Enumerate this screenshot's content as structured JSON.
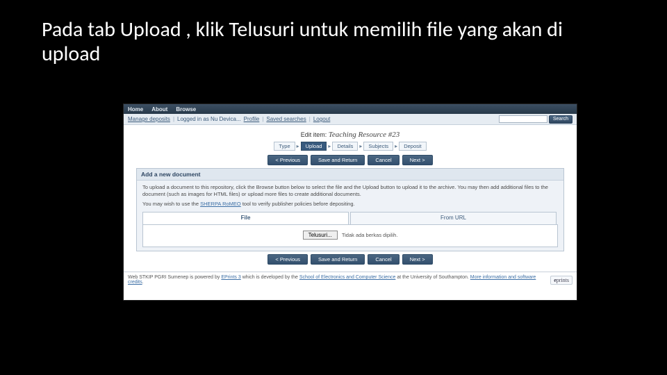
{
  "slide": {
    "title": "Pada tab Upload , klik Telusuri untuk memilih file yang akan di upload"
  },
  "nav": {
    "home": "Home",
    "about": "About",
    "browse": "Browse"
  },
  "userbar": {
    "manage": "Manage deposits",
    "logged": "Logged in as Nu Devica...",
    "profile": "Profile",
    "saved": "Saved searches",
    "logout": "Logout"
  },
  "search": {
    "placeholder": "",
    "button": "Search"
  },
  "edit": {
    "prefix": "Edit item:",
    "itemname": "Teaching Resource #23",
    "steps": [
      "Type",
      "Upload",
      "Details",
      "Subjects",
      "Deposit"
    ],
    "activeIndex": 1
  },
  "buttons": {
    "prev": "< Previous",
    "save": "Save and Return",
    "cancel": "Cancel",
    "next": "Next >"
  },
  "panel": {
    "heading": "Add a new document",
    "p1a": "To upload a document to this repository, click the Browse button below to select the file and the Upload button to upload it to the archive. You may then add additional files to the document (such as images for HTML files) or upload more files to create additional documents.",
    "p2a": "You may wish to use the ",
    "p2link": "SHERPA RoMEO",
    "p2b": " tool to verify publisher policies before depositing."
  },
  "tabs": {
    "file": "File",
    "url": "From URL"
  },
  "fileinput": {
    "browse": "Telusuri...",
    "nofile": "Tidak ada berkas dipilih."
  },
  "footer": {
    "text1": "Web STKIP PGRI Sumenep is powered by ",
    "link1": "EPrints 3",
    "text2": " which is developed by the ",
    "link2": "School of Electronics and Computer Science",
    "text3": " at the University of Southampton. ",
    "link3": "More information and software credits",
    "logo": "eprints"
  }
}
